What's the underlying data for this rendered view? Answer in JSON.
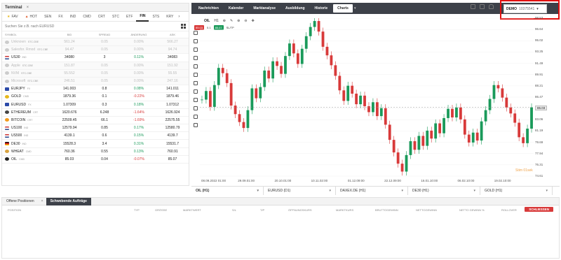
{
  "terminal": {
    "title": "Terminal",
    "close_glyph": "×",
    "categories": [
      {
        "label": "FAV",
        "icon": "star"
      },
      {
        "label": "HOT",
        "icon": "flame"
      },
      {
        "label": "SEN"
      },
      {
        "label": "FX"
      },
      {
        "label": "IND"
      },
      {
        "label": "CMD"
      },
      {
        "label": "CRT"
      },
      {
        "label": "STC"
      },
      {
        "label": "ETF"
      },
      {
        "label": "FIN"
      },
      {
        "label": "STS"
      },
      {
        "label": "KRY"
      }
    ],
    "active_category": "FIN",
    "search_placeholder": "Suchen Sie z.B. nach EURUSD",
    "columns": {
      "symbol": "SYMBOL",
      "bid": "BID",
      "spread": "SPREAD",
      "change": "ÄNDERUNG",
      "ask": "ASK"
    },
    "rows": [
      {
        "symbol": "Unknown",
        "sub": "STC.CBE",
        "bid": "561.24",
        "spread": "0.05",
        "change": "0.00%",
        "ask": "566.27",
        "dim": true,
        "flag": "gray"
      },
      {
        "symbol": "Salesfor. Rmod",
        "sub": "STC.CBE",
        "bid": "94.47",
        "spread": "0.05",
        "change": "0.00%",
        "ask": "94.74",
        "dim": true,
        "flag": "gray"
      },
      {
        "symbol": "US30",
        "sub": "IND",
        "bid": "34080",
        "spread": "3",
        "change": "0.11%",
        "ask": "34083",
        "dim": false,
        "flag": "us",
        "dir": "pos"
      },
      {
        "symbol": "Apple",
        "sub": "STC.CBE",
        "bid": "151.87",
        "spread": "0.05",
        "change": "0.00%",
        "ask": "151.92",
        "dim": true,
        "flag": "gray"
      },
      {
        "symbol": "NVM",
        "sub": "STC.CBE",
        "bid": "55.552",
        "spread": "0.05",
        "change": "0.00%",
        "ask": "55.55",
        "dim": true,
        "flag": "gray"
      },
      {
        "symbol": "Microsoft",
        "sub": "STC.CBE",
        "bid": "246.51",
        "spread": "0.05",
        "change": "0.00%",
        "ask": "247.16",
        "dim": true,
        "flag": "gray"
      },
      {
        "symbol": "EURJPY",
        "sub": "FX",
        "bid": "141.003",
        "spread": "0.8",
        "change": "0.08%",
        "ask": "141.011",
        "dim": false,
        "flag": "eu",
        "dir": "pos"
      },
      {
        "symbol": "GOLD",
        "sub": "CMD",
        "bid": "1879.36",
        "spread": "0.1",
        "change": "-0.22%",
        "ask": "1879.46",
        "dim": false,
        "flag": "gold",
        "dir": "neg"
      },
      {
        "symbol": "EURUSD",
        "sub": "FX",
        "bid": "1.07309",
        "spread": "0.3",
        "change": "0.18%",
        "ask": "1.07312",
        "dim": false,
        "flag": "eu",
        "dir": "pos"
      },
      {
        "symbol": "ETHEREUM",
        "sub": "CRT",
        "bid": "1620.676",
        "spread": "6.248",
        "change": "-1.64%",
        "ask": "1626.924",
        "dim": false,
        "flag": "eth",
        "dir": "neg"
      },
      {
        "symbol": "BITCOIN",
        "sub": "CRT",
        "bid": "22509.45",
        "spread": "66.1",
        "change": "-1.69%",
        "ask": "22575.55",
        "dim": false,
        "flag": "btc",
        "dir": "neg"
      },
      {
        "symbol": "US100",
        "sub": "IND",
        "bid": "12579.94",
        "spread": "0.85",
        "change": "0.17%",
        "ask": "12580.79",
        "dim": false,
        "flag": "us",
        "dir": "pos"
      },
      {
        "symbol": "US500",
        "sub": "IND",
        "bid": "4139.1",
        "spread": "0.6",
        "change": "0.15%",
        "ask": "4139.7",
        "dim": false,
        "flag": "us",
        "dir": "pos"
      },
      {
        "symbol": "DE30",
        "sub": "IND",
        "bid": "15528.3",
        "spread": "3.4",
        "change": "0.31%",
        "ask": "15531.7",
        "dim": false,
        "flag": "de",
        "dir": "pos"
      },
      {
        "symbol": "WHEAT",
        "sub": "CMD",
        "bid": "760.36",
        "spread": "0.55",
        "change": "0.13%",
        "ask": "760.91",
        "dim": false,
        "flag": "wheat",
        "dir": "pos"
      },
      {
        "symbol": "OIL",
        "sub": "CMD",
        "bid": "85.03",
        "spread": "0.04",
        "change": "-0.07%",
        "ask": "85.07",
        "dim": false,
        "flag": "oil",
        "dir": "neg"
      }
    ]
  },
  "top_tabs": [
    "Nachrichten",
    "Kalender",
    "Marktanalyse",
    "Ausbildung",
    "Historie"
  ],
  "charts_tab": "Charts",
  "account": {
    "mode": "DEMO",
    "number": "10375541"
  },
  "chart_toolbar": {
    "symbol": "OIL",
    "timeframe": "H1",
    "sell_price": "85.03",
    "spread": "0.1",
    "buy_price": "85.07",
    "sltp": "SL/TP"
  },
  "chart_data": {
    "type": "line",
    "symbol": "OIL",
    "ylim": [
      74.61,
      98.53
    ],
    "y_ticks": [
      "98.53",
      "96.64",
      "95.02",
      "93.25",
      "91.49",
      "89.91",
      "88.21",
      "86.47",
      "84.71",
      "83.06",
      "81.19",
      "79.69",
      "77.94",
      "76.31",
      "74.61"
    ],
    "current_price": "85.03",
    "x_ticks": [
      "08.09.2022 01:00",
      "29.09.01:00",
      "20.10.01:00",
      "10.11.02:00",
      "01.12.09:00",
      "22.12.09:00",
      "16.01.10:00",
      "06.02.10:00",
      "19.02.10:00"
    ],
    "series": [
      {
        "values": [
          86.2,
          87.5,
          85.1,
          88.4,
          91.0,
          90.2,
          88.7,
          85.3,
          84.0,
          82.8,
          81.9,
          84.6,
          87.9,
          86.4,
          88.1,
          90.6,
          89.4,
          92.0,
          91.3,
          90.1,
          92.8,
          94.7,
          93.2,
          91.6,
          93.9,
          95.8,
          97.2,
          98.1,
          96.5,
          94.2,
          92.9,
          91.4,
          89.8,
          87.6,
          86.0,
          88.3,
          87.1,
          85.5,
          86.8,
          85.2,
          84.3,
          85.8,
          83.7,
          84.9,
          82.4,
          80.1,
          78.2,
          76.5,
          75.3,
          77.8,
          79.9,
          78.6,
          80.7,
          79.2,
          81.5,
          80.3,
          82.6,
          81.1,
          83.4,
          84.8,
          83.5,
          85.0,
          83.2,
          80.9,
          79.7,
          81.2,
          80.0,
          82.9,
          84.6,
          86.3,
          88.4,
          87.9,
          86.5,
          85.0,
          84.1,
          82.7,
          80.5,
          79.6,
          81.8,
          85.03
        ]
      }
    ]
  },
  "watermark": "Stim 01sek",
  "instrument_tabs": [
    {
      "label": "OIL (H1)",
      "active": true
    },
    {
      "label": "EURUSD (D1)",
      "active": false
    },
    {
      "label": "DAXEX.DE (H1)",
      "active": false
    },
    {
      "label": "DE30 (H1)",
      "active": false
    },
    {
      "label": "GOLD (H1)",
      "active": false
    }
  ],
  "positions": {
    "tabs": [
      "Offene Positionen",
      "Schwebende Aufträge"
    ],
    "active_tab": "Schwebende Aufträge",
    "columns": [
      "POSITION",
      "TYP",
      "GRÖSSE",
      "MARKTWERT",
      "S/L",
      "T/P",
      "ÖFFNUNGSKURS",
      "MARKTKURS",
      "BRUTTOGEWINN",
      "NETTOGEWINN",
      "NETTO GEWINN %",
      "ROLLOVER"
    ],
    "close_label": "SCHLIESSEN"
  },
  "colors": {
    "accent_dark": "#3d4149",
    "up": "#1a9a5a",
    "down": "#d83a3a",
    "highlight_box": "#e01010"
  }
}
